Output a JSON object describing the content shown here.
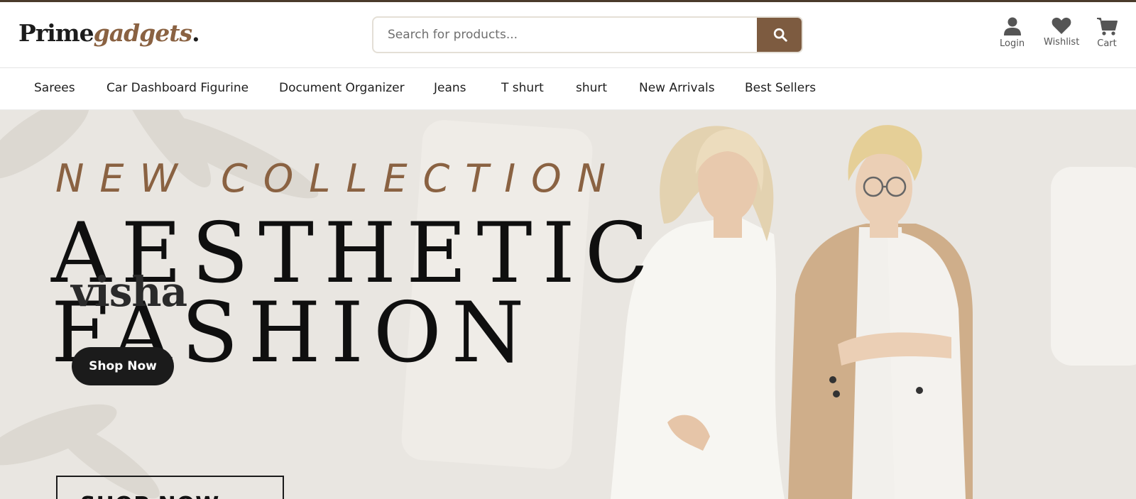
{
  "brand": {
    "name_part1": "Prime",
    "name_part2": "gadgets",
    "name_dot": "."
  },
  "search": {
    "placeholder": "Search for products...",
    "icon": "search-icon"
  },
  "header_actions": [
    {
      "label": "Login",
      "icon": "user-icon"
    },
    {
      "label": "Wishlist",
      "icon": "heart-icon"
    },
    {
      "label": "Cart",
      "icon": "cart-icon"
    }
  ],
  "nav": {
    "items": [
      {
        "label": "Sarees"
      },
      {
        "label": "Car Dashboard Figurine"
      },
      {
        "label": "Document Organizer"
      },
      {
        "label": "Jeans"
      },
      {
        "label": "T shurt"
      },
      {
        "label": "shurt"
      },
      {
        "label": "New Arrivals"
      },
      {
        "label": "Best Sellers"
      }
    ]
  },
  "hero": {
    "eyebrow": "NEW COLLECTION",
    "headline_line1": "AESTHETIC",
    "headline_line2": "FASHION",
    "overlay_brand": "visha",
    "cta_primary": "Shop Now",
    "cta_secondary": "SHOP NOW"
  },
  "colors": {
    "accent": "#8a6242",
    "search_button": "#7d5b40",
    "dark": "#1b1b1b",
    "hero_bg": "#e9e6e1",
    "top_strip": "#4a3a2b"
  }
}
